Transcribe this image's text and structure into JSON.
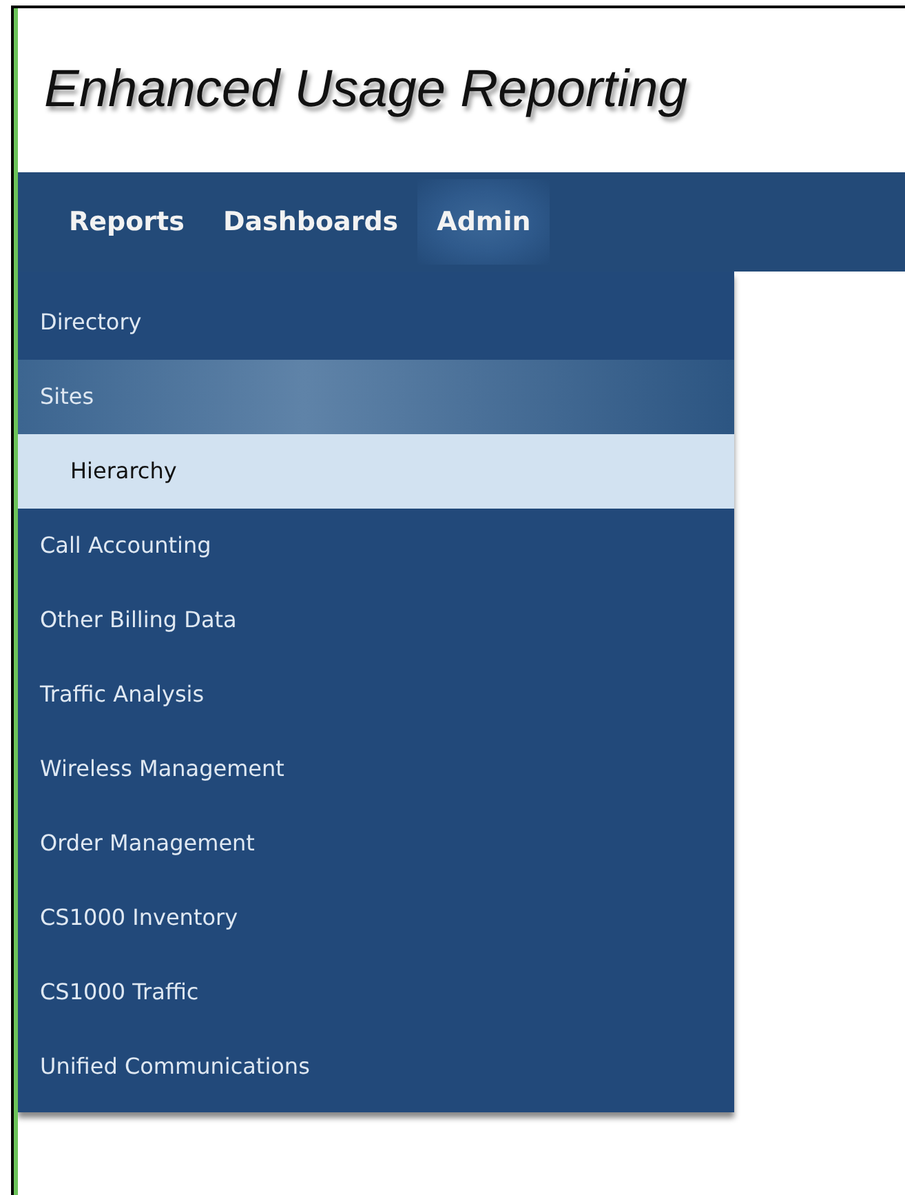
{
  "app_title": "Enhanced Usage Reporting",
  "nav": [
    {
      "label": "Reports",
      "selected": false
    },
    {
      "label": "Dashboards",
      "selected": false
    },
    {
      "label": "Admin",
      "selected": true
    }
  ],
  "menu": [
    {
      "label": "Directory",
      "hover": false,
      "selected": false
    },
    {
      "label": "Sites",
      "hover": true,
      "selected": false,
      "children": [
        {
          "label": "Hierarchy",
          "hover": false,
          "selected": true
        }
      ]
    },
    {
      "label": "Call Accounting",
      "hover": false,
      "selected": false
    },
    {
      "label": "Other Billing Data",
      "hover": false,
      "selected": false
    },
    {
      "label": "Traffic Analysis",
      "hover": false,
      "selected": false
    },
    {
      "label": "Wireless Management",
      "hover": false,
      "selected": false
    },
    {
      "label": "Order Management",
      "hover": false,
      "selected": false
    },
    {
      "label": "CS1000 Inventory",
      "hover": false,
      "selected": false
    },
    {
      "label": "CS1000 Traffic",
      "hover": false,
      "selected": false
    },
    {
      "label": "Unified Communications",
      "hover": false,
      "selected": false
    }
  ]
}
